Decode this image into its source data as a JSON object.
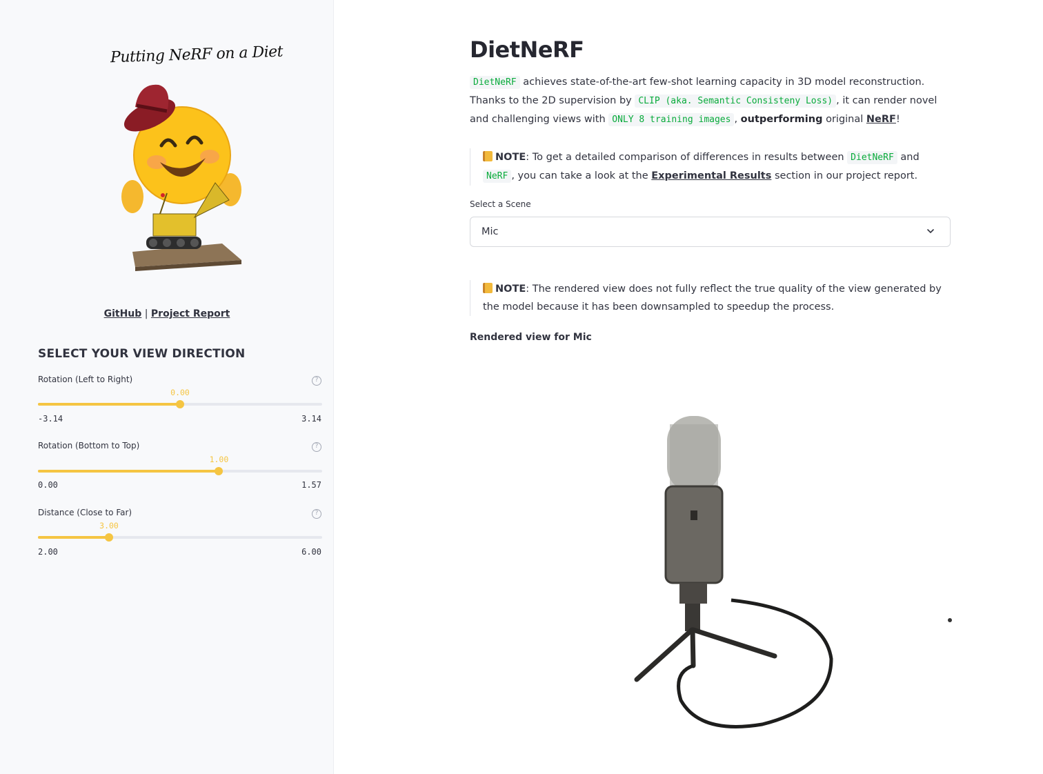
{
  "sidebar": {
    "logo_text": "Putting NeRF on a Diet",
    "mascot_icon": "smiling-emoji-with-hat-and-lego-bulldozer",
    "links": {
      "github": "GitHub",
      "separator": "|",
      "report": "Project Report"
    },
    "heading": "SELECT YOUR VIEW DIRECTION",
    "sliders": [
      {
        "label": "Rotation (Left to Right)",
        "value": "0.00",
        "min": "-3.14",
        "max": "3.14",
        "fraction": 0.5
      },
      {
        "label": "Rotation (Bottom to Top)",
        "value": "1.00",
        "min": "0.00",
        "max": "1.57",
        "fraction": 0.637
      },
      {
        "label": "Distance (Close to Far)",
        "value": "3.00",
        "min": "2.00",
        "max": "6.00",
        "fraction": 0.25
      }
    ],
    "help_icon": "question-circle-icon",
    "accent_color": "#f5c542"
  },
  "main": {
    "title": "DietNeRF",
    "intro": {
      "code1": "DietNeRF",
      "t1": " achieves state-of-the-art few-shot learning capacity in 3D model reconstruction. Thanks to the 2D supervision by ",
      "code2": "CLIP (aka. Semantic Consisteny Loss)",
      "t2": ", it can render novel and challenging views with ",
      "code3": "ONLY 8 training images",
      "t3": ", ",
      "bold": "outperforming",
      "t4": " original ",
      "link": "NeRF",
      "t5": "!"
    },
    "note1": {
      "label": "NOTE",
      "t1": ": To get a detailed comparison of differences in results between ",
      "code1": "DietNeRF",
      "t2": " and ",
      "code2": "NeRF",
      "t3": ", you can take a look at the ",
      "link": "Experimental Results",
      "t4": " section in our project report."
    },
    "select": {
      "label": "Select a Scene",
      "value": "Mic"
    },
    "note2": {
      "label": "NOTE",
      "text": ": The rendered view does not fully reflect the true quality of the view generated by the model because it has been downsampled to speedup the process."
    },
    "render_label": "Rendered view for Mic",
    "render_image": "microphone-on-tripod-render"
  }
}
